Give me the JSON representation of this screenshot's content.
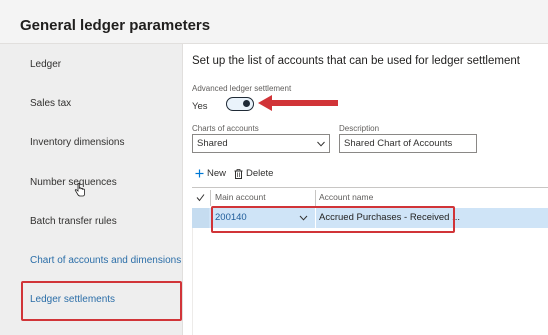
{
  "header": {
    "title": "General ledger parameters"
  },
  "sidebar": {
    "items": [
      {
        "label": "Ledger"
      },
      {
        "label": "Sales tax"
      },
      {
        "label": "Inventory dimensions"
      },
      {
        "label": "Number sequences"
      },
      {
        "label": "Batch transfer rules"
      },
      {
        "label": "Chart of accounts and dimensions"
      },
      {
        "label": "Ledger settlements"
      }
    ],
    "selected": "Ledger settlements"
  },
  "main": {
    "heading": "Set up the list of accounts that can be used for ledger settlement",
    "advanced_settlement": {
      "label": "Advanced ledger settlement",
      "value": "Yes",
      "on": true
    },
    "charts_of_accounts": {
      "label": "Charts of accounts",
      "value": "Shared"
    },
    "description": {
      "label": "Description",
      "value": "Shared Chart of Accounts"
    },
    "actions": {
      "new_label": "New",
      "delete_label": "Delete"
    },
    "grid": {
      "columns": [
        "Main account",
        "Account name"
      ],
      "rows": [
        {
          "main_account": "200140",
          "account_name": "Accrued Purchases - Received ..."
        }
      ]
    }
  },
  "colors": {
    "highlight": "#d13438",
    "link": "#2b6ea8",
    "row_selected": "#cfe4f7",
    "toggle_on": "#1f2a36"
  },
  "icons": [
    "check-icon",
    "plus-icon",
    "trash-icon",
    "chevron-down-icon",
    "hand-cursor-icon",
    "red-arrow-icon"
  ]
}
